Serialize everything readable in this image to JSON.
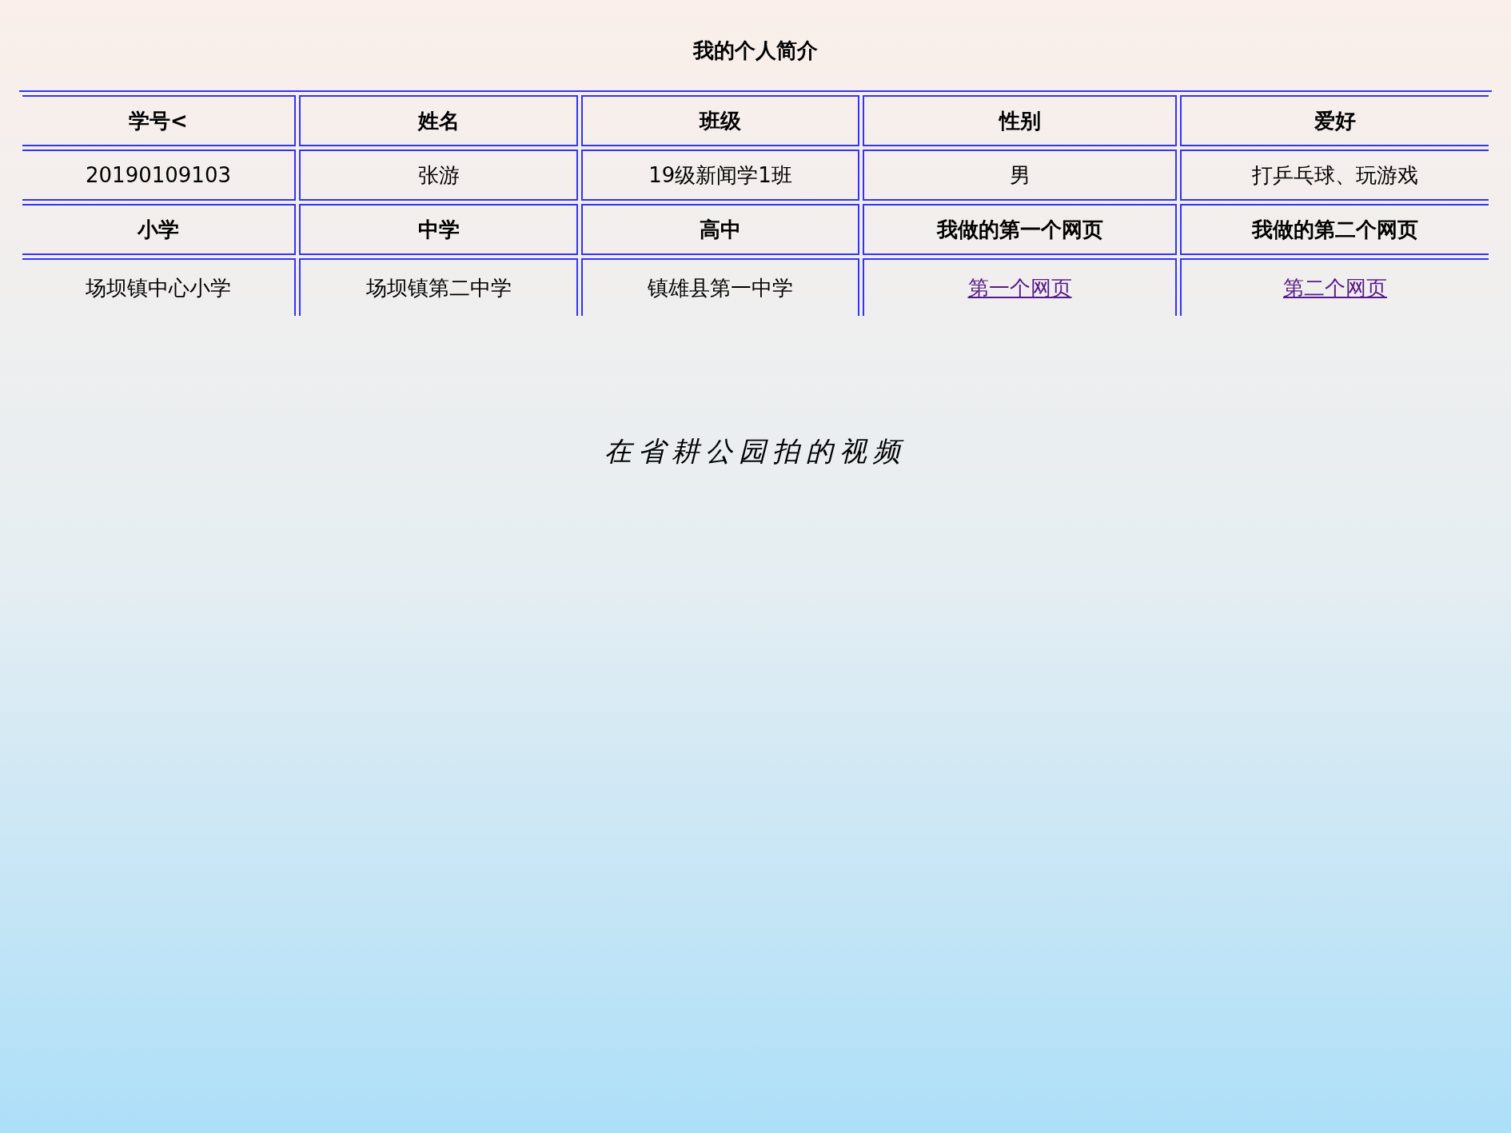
{
  "title": "我的个人简介",
  "table": {
    "rows": [
      {
        "kind": "header",
        "cells": [
          {
            "kind": "text",
            "text": "学号<"
          },
          {
            "kind": "text",
            "text": "姓名"
          },
          {
            "kind": "text",
            "text": "班级"
          },
          {
            "kind": "text",
            "text": "性别"
          },
          {
            "kind": "text",
            "text": "爱好"
          }
        ]
      },
      {
        "kind": "data",
        "cells": [
          {
            "kind": "text",
            "text": "20190109103"
          },
          {
            "kind": "text",
            "text": "张游"
          },
          {
            "kind": "text",
            "text": "19级新闻学1班"
          },
          {
            "kind": "text",
            "text": "男"
          },
          {
            "kind": "text",
            "text": "打乒乓球、玩游戏"
          }
        ]
      },
      {
        "kind": "header",
        "cells": [
          {
            "kind": "text",
            "text": "小学"
          },
          {
            "kind": "text",
            "text": "中学"
          },
          {
            "kind": "text",
            "text": "高中"
          },
          {
            "kind": "text",
            "text": "我做的第一个网页"
          },
          {
            "kind": "text",
            "text": "我做的第二个网页"
          }
        ]
      },
      {
        "kind": "data",
        "cells": [
          {
            "kind": "text",
            "text": "场坝镇中心小学"
          },
          {
            "kind": "text",
            "text": "场坝镇第二中学"
          },
          {
            "kind": "text",
            "text": "镇雄县第一中学"
          },
          {
            "kind": "link",
            "text": "第一个网页"
          },
          {
            "kind": "link",
            "text": "第二个网页"
          }
        ]
      }
    ]
  },
  "video_caption": "在省耕公园拍的视频"
}
